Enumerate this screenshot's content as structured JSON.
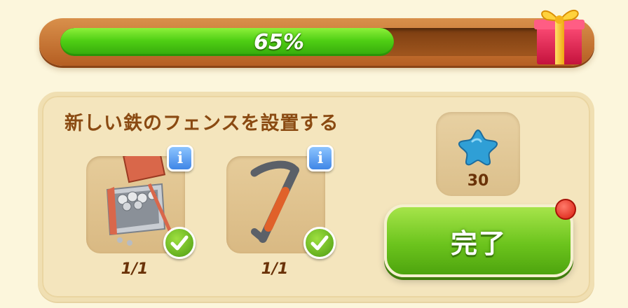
{
  "progress": {
    "percent": 65,
    "label": "65%"
  },
  "quest": {
    "title": "新しい鉄のフェンスを設置する",
    "requirements": [
      {
        "icon": "toolbox-with-bolts-icon",
        "count": "1/1",
        "complete": true
      },
      {
        "icon": "crowbar-icon",
        "count": "1/1",
        "complete": true
      }
    ],
    "reward": {
      "icon": "blue-star-icon",
      "amount": "30"
    },
    "complete_button": "完了"
  },
  "colors": {
    "progress_fill": "#4fcf14",
    "button_green": "#6cc41d",
    "title_brown": "#8a4a12",
    "notify_red": "#d81c0e",
    "info_blue": "#3f86e6"
  }
}
